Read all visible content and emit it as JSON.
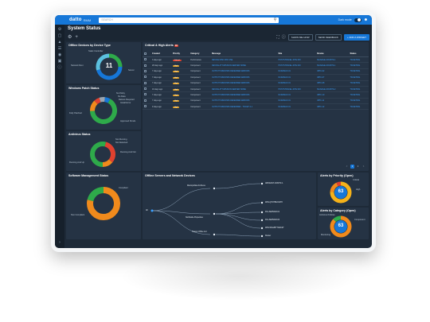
{
  "app": {
    "logo": "datto",
    "logo_sub": "RMM",
    "search_placeholder": "SEARCH",
    "dark_mode_label": "Dark mode"
  },
  "page": {
    "title": "System Status"
  },
  "toolbar": {
    "show_me_how": "SHOW ME HOW",
    "send_feedback": "SEND FEEDBACK",
    "add_widget": "+ ADD A WIDGET"
  },
  "widgets": {
    "offline": {
      "title": "Offline Devices by Device Type",
      "center": "11",
      "labels": [
        "Static Controller",
        "Network Devi",
        "Server"
      ]
    },
    "patch": {
      "title": "Windows Patch Status",
      "labels": [
        "No Policy",
        "No Data",
        "Reboot Required",
        "Install Error",
        "Fully Patched",
        "Approved Pends"
      ]
    },
    "antivirus": {
      "title": "Antivirus Status",
      "labels": [
        "Not Running",
        "Not Detected",
        "Running And Not",
        "Running And Up"
      ]
    },
    "software": {
      "title": "Software Management Status",
      "labels": [
        "Compliant",
        "Non Compliant"
      ]
    },
    "alerts": {
      "title": "Critical & High Alerts",
      "badge": "10",
      "columns": [
        "Created",
        "Priority",
        "Category",
        "Message",
        "Site",
        "Device",
        "Status"
      ],
      "rows": [
        [
          "3 days ago",
          "Critical",
          "Performance",
          "DEVICE DISK 90% USE",
          "HOSTSTRAVEL-SITE 003",
          "MANAGE-CRUSTS-1",
          "TICKETING"
        ],
        [
          "28 days ago",
          "High",
          "Component",
          "DEVICE ATT-MISSION-SERVER SOME",
          "HOSTSTRAVEL-SITE 003",
          "MANAGE-CRUSTS-1",
          "TICKETING"
        ],
        [
          "7 days ago",
          "High",
          "Component",
          "OUTPUT WINDOWS DEFENDER ERRORS",
          "NURAMAX-01",
          "WPC-02",
          "TICKETING"
        ],
        [
          "7 days ago",
          "High",
          "Component",
          "OUTPUT WINDOWS DEFENDER ERRORS",
          "NURAMAX-01",
          "WPC-07",
          "TICKETING"
        ],
        [
          "7 days ago",
          "High",
          "Component",
          "OUTPUT WINDOWS DEFENDER ERRORS",
          "NURAMAX-01",
          "WPC-08",
          "TICKETING"
        ],
        [
          "16 days ago",
          "High",
          "Component",
          "DEVICE ATT-MISSION-SERVER SOME",
          "HOSTSTRAVEL-SITE 003",
          "MANAGE-CRUSTS-2",
          "TICKETING"
        ],
        [
          "7 days ago",
          "High",
          "Component",
          "OUTPUT WINDOWS DEFENDER ERRORS",
          "NURAMAX-01",
          "WPC-10",
          "TICKETING"
        ],
        [
          "7 days ago",
          "High",
          "Component",
          "OUTPUT WINDOWS DEFENDER ERRORS",
          "NURAMAX-01",
          "WPC-11",
          "TICKETING"
        ],
        [
          "9 days ago",
          "High",
          "Component",
          "OUTPUT WINDOWS DEFENDER - TICKET 2.1",
          "NURAMAX-01",
          "WPC-12",
          "TICKETING"
        ]
      ],
      "pages": [
        "<",
        "1",
        "2",
        ">"
      ]
    },
    "network": {
      "title": "Offline Servers and Network Devices",
      "root": "All",
      "sites": [
        "Metropolitan Archives",
        "Northside Properties",
        "Towers Office Ltd"
      ],
      "devices": [
        "ABINGINT-CDNTR-1",
        "WIN-QTNTBUO4PH",
        "FIG-SERVER-01",
        "FIG-SERVER-02",
        "WIN-5FG2BTTNAK2T",
        "WIN-4BQL3NVC4B",
        "Router"
      ]
    },
    "priority": {
      "title": "Alerts by Priority (Open)",
      "center": "63",
      "labels": [
        "Critical",
        "High",
        "Moderate"
      ]
    },
    "category": {
      "title": "Alerts by Category (Open)",
      "center": "63",
      "labels": [
        "Antivirus Policies",
        "Component",
        "Monitoring"
      ]
    }
  },
  "colors": {
    "green": "#2eaa4a",
    "orange": "#f08a1c",
    "blue": "#1677d8",
    "critical": "#e0412f",
    "high": "#e6a120",
    "amber": "#f5b21a"
  }
}
